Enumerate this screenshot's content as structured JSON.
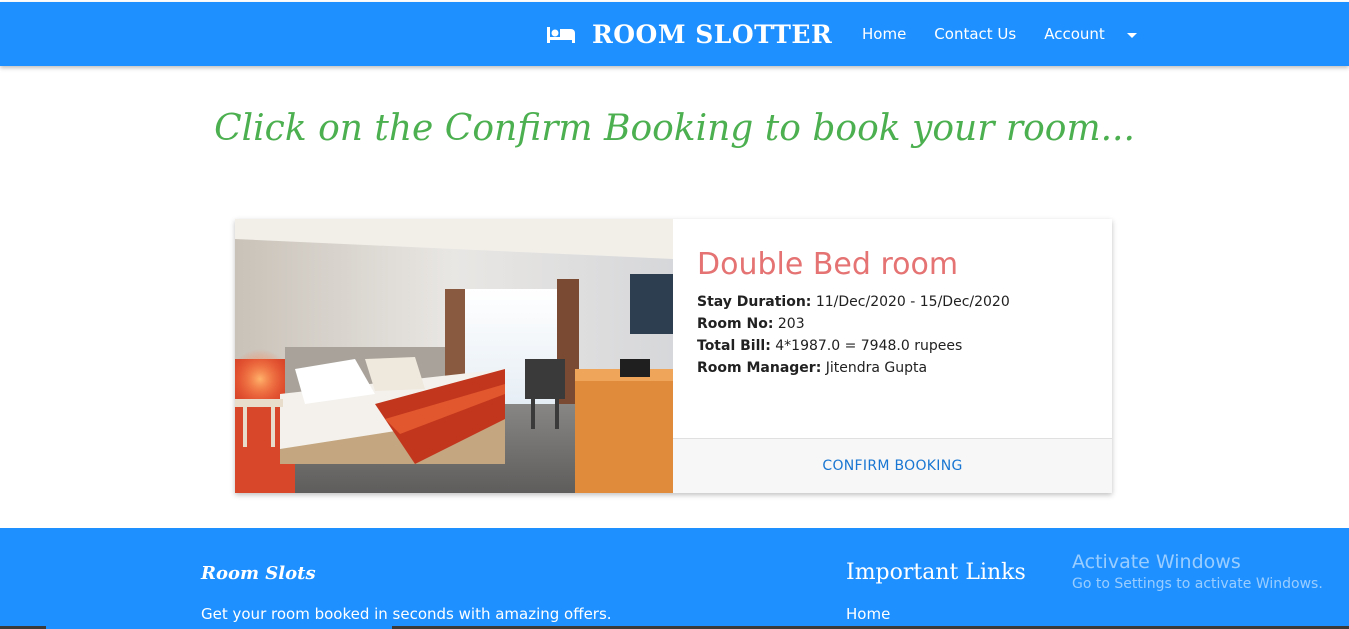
{
  "navbar": {
    "brand": "ROOM SLOTTER",
    "links": [
      {
        "label": "Home"
      },
      {
        "label": "Contact Us"
      },
      {
        "label": "Account"
      }
    ],
    "background": "#1e90ff"
  },
  "headline": "Click on the Confirm Booking to book your room...",
  "booking": {
    "title": "Double Bed room",
    "details": [
      {
        "label": "Stay Duration:",
        "value": "11/Dec/2020 - 15/Dec/2020"
      },
      {
        "label": "Room No:",
        "value": "203"
      },
      {
        "label": "Total Bill:",
        "value": "4*1987.0 = 7948.0 rupees"
      },
      {
        "label": "Room Manager:",
        "value": "Jitendra Gupta"
      }
    ],
    "action_label": "CONFIRM BOOKING"
  },
  "footer": {
    "brand": "Room Slots",
    "description": "Get your room booked in seconds with amazing offers.",
    "links_title": "Important Links",
    "links": [
      {
        "label": "Home"
      }
    ]
  },
  "watermark": {
    "title": "Activate Windows",
    "subtitle": "Go to Settings to activate Windows."
  },
  "colors": {
    "primary": "#1e90ff",
    "headline": "#4caf50",
    "room_title": "#e57373",
    "action": "#1976d2"
  }
}
